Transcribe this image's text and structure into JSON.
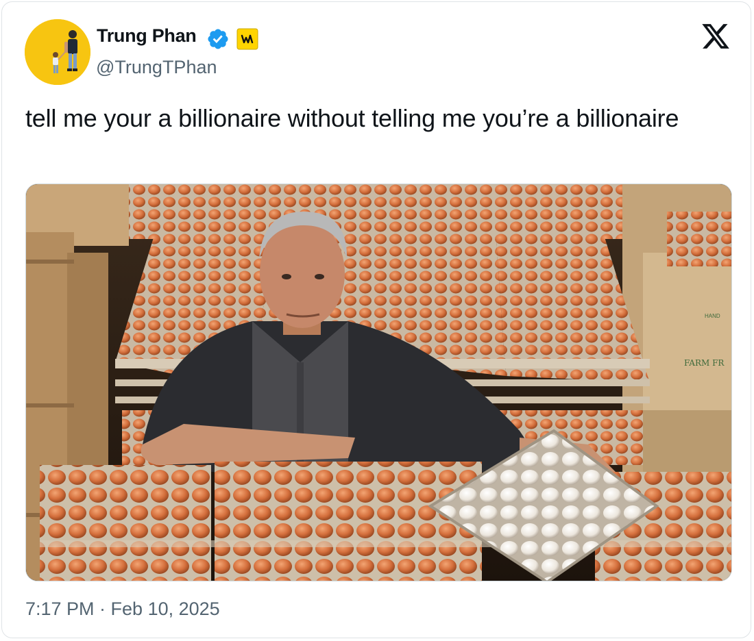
{
  "author": {
    "display_name": "Trung Phan",
    "handle": "@TrungTPhan",
    "verified": true,
    "avatar_icon": "avatar-photo-person-walking-with-child",
    "affiliation_badge_icon": "w-badge-icon"
  },
  "tweet": {
    "text": "tell me your a billionaire without telling me you’re a billionaire",
    "timestamp": "7:17 PM · Feb 10, 2025"
  },
  "media": {
    "alt": "Man seated among stacked trays of brown and white eggs",
    "box_labels": [
      "FARM FR",
      "HAND"
    ]
  },
  "brand": {
    "logo_icon": "x-logo-icon"
  },
  "colors": {
    "text_primary": "#0f1419",
    "text_secondary": "#536471",
    "verified_blue": "#1d9bf0",
    "avatar_bg": "#f7c511",
    "badge_yellow": "#ffd400"
  }
}
